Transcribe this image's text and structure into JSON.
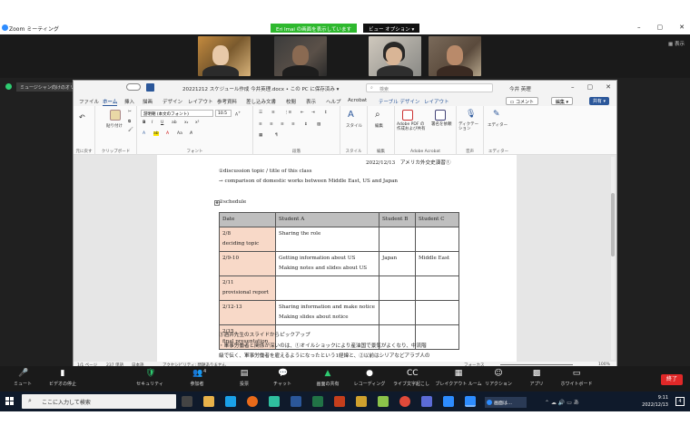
{
  "zoom": {
    "window_title": "Zoom ミーティング",
    "share_banner": "Eri Imai の画面を表示しています",
    "view_options": "ビュー オプション ▾",
    "view_label": "表示",
    "audio_chip": "ミュージシャン向けのオリジナル音声…",
    "controls": [
      {
        "label": "ミュート",
        "icon": "🎤"
      },
      {
        "label": "ビデオの停止",
        "icon": "▮"
      },
      {
        "label": "セキュリティ",
        "icon": "🛡"
      },
      {
        "label": "参加者",
        "icon": "👥"
      },
      {
        "label": "投票",
        "icon": "▤"
      },
      {
        "label": "チャット",
        "icon": "💬"
      },
      {
        "label": "画面の共有",
        "icon": "▲"
      },
      {
        "label": "レコーディング",
        "icon": "●"
      },
      {
        "label": "ライブ文字起こし",
        "icon": "CC"
      },
      {
        "label": "ブレイクアウト ルーム",
        "icon": "▦"
      },
      {
        "label": "リアクション",
        "icon": "☺"
      },
      {
        "label": "アプリ",
        "icon": "▩"
      },
      {
        "label": "ホワイトボード",
        "icon": "▭"
      }
    ],
    "participants_count": "4",
    "end_label": "終了"
  },
  "word": {
    "doc_title": "20221212 スケジュール作成 今井英理.docx • この PC に保存済み ▾",
    "search_placeholder": "検索",
    "user": "今井 英理",
    "tabs": [
      "ファイル",
      "ホーム",
      "挿入",
      "描画",
      "デザイン",
      "レイアウト",
      "参考資料",
      "差し込み文書",
      "校閲",
      "表示",
      "ヘルプ",
      "Acrobat",
      "テーブル デザイン",
      "レイアウト"
    ],
    "comment_label": "コメント",
    "edit_label": "編集 ▾",
    "share_label": "共有 ▾",
    "font_name": "游明朝 (本文のフォント)",
    "font_size": "10.5",
    "ribbon_groups": [
      "元に戻す",
      "クリップボード",
      "フォント",
      "段落",
      "スタイル",
      "編集",
      "Adobe Acrobat",
      "音声",
      "エディター"
    ],
    "ribbon_buttons": {
      "paste": "貼り付け",
      "style": "スタイル",
      "edit": "編集",
      "pdf": "Adobe PDF の作成および共有",
      "sign": "署名を依頼",
      "dictate": "ディクテーション",
      "editor": "エディター"
    },
    "status": {
      "page": "1/1 ページ",
      "words": "237 単語",
      "lang": "日本語",
      "a11y": "アクセシビリティ: 問題ありません",
      "focus": "フォーカス",
      "zoom": "100%"
    }
  },
  "document": {
    "date_line": "2022/12/13　アメリカ外交史演習①",
    "topic_heading": "①discussion topic / title of this class",
    "topic_arrow": "→ comparison of domestic works between Middle East, US and Japan",
    "schedule_heading": "②schedule",
    "table": {
      "headers": [
        "Date",
        "Student A",
        "Student B",
        "Student C"
      ],
      "rows": [
        {
          "date": [
            "2/8",
            "deciding topic"
          ],
          "a": [
            "Sharing the role"
          ],
          "b": "",
          "c": ""
        },
        {
          "date": [
            "2/9-10",
            ""
          ],
          "a": [
            "Getting information about US",
            "Making notes and slides about US"
          ],
          "b": "Japan",
          "c": "Middle East"
        },
        {
          "date": [
            "2/11",
            "provisional report"
          ],
          "a": [
            "",
            ""
          ],
          "b": "",
          "c": ""
        },
        {
          "date": [
            "2/12-13",
            ""
          ],
          "a": [
            "Sharing information and make notice",
            "Making slides about notice"
          ],
          "b": "",
          "c": ""
        },
        {
          "date": [
            "2/15",
            "final presentation"
          ],
          "a": [
            "",
            ""
          ],
          "b": "",
          "c": ""
        }
      ]
    },
    "section3_heading": "③酒井先生のスライドからピックアップ",
    "section3_line1": "・軍事労働者と関係が深いのは、①オイルショックにより産油国で景気がよくなり、中流階",
    "section3_line2": "級で伝く、軍事労働者を雇えるようになったという1経緯と、②以前はシリアなどアラブ人の"
  },
  "taskbar": {
    "search_placeholder": "ここに入力して検索",
    "active_app": "画面は…",
    "time": "9:11",
    "date": "2022/12/13",
    "badge": "4"
  },
  "colors": {
    "zoom_green": "#2eb82e",
    "word_blue": "#2b579a",
    "end_red": "#e02828",
    "header_grey": "#bfbfbf",
    "date_peach": "#f8d9c8"
  }
}
